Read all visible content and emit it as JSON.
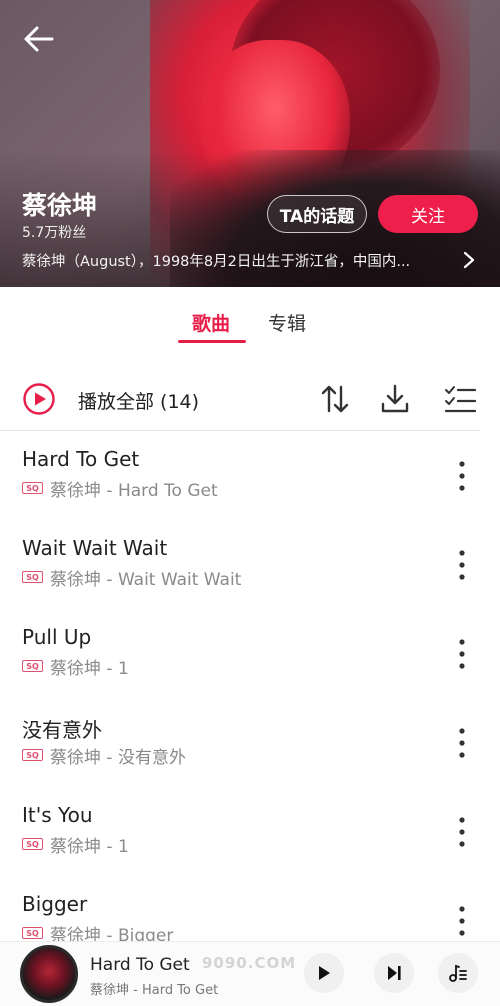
{
  "header": {
    "artist_name": "蔡徐坤",
    "fans": "5.7万粉丝",
    "bio": "蔡徐坤（August），1998年8月2日出生于浙江省，中国内...",
    "topic_button": "TA的话题",
    "follow_button": "关注"
  },
  "tabs": [
    {
      "label": "歌曲",
      "active": true
    },
    {
      "label": "专辑",
      "active": false
    }
  ],
  "toolbar": {
    "play_all_label": "播放全部 (14)"
  },
  "songs": [
    {
      "title": "Hard To Get",
      "meta": "蔡徐坤 - Hard To Get",
      "quality": "SQ"
    },
    {
      "title": "Wait Wait Wait",
      "meta": "蔡徐坤 - Wait Wait Wait",
      "quality": "SQ"
    },
    {
      "title": "Pull Up",
      "meta": "蔡徐坤 - 1",
      "quality": "SQ"
    },
    {
      "title": "没有意外",
      "meta": "蔡徐坤 - 没有意外",
      "quality": "SQ"
    },
    {
      "title": "It's You",
      "meta": "蔡徐坤 - 1",
      "quality": "SQ"
    },
    {
      "title": "Bigger",
      "meta": "蔡徐坤 - Bigger",
      "quality": "SQ"
    }
  ],
  "mini_player": {
    "title": "Hard To Get",
    "subtitle": "蔡徐坤 - Hard To Get",
    "watermark": "9090.COM"
  },
  "colors": {
    "accent": "#e81e4a",
    "follow_button": "#ee1f4b",
    "sq_badge": "#e0506f"
  },
  "icons": {
    "back": "arrow-left",
    "play_all": "play-circle",
    "sort": "sort-arrows",
    "download": "download",
    "multiselect": "checklist",
    "more": "vertical-dots",
    "play": "play",
    "next": "skip-next",
    "queue": "music-queue"
  }
}
